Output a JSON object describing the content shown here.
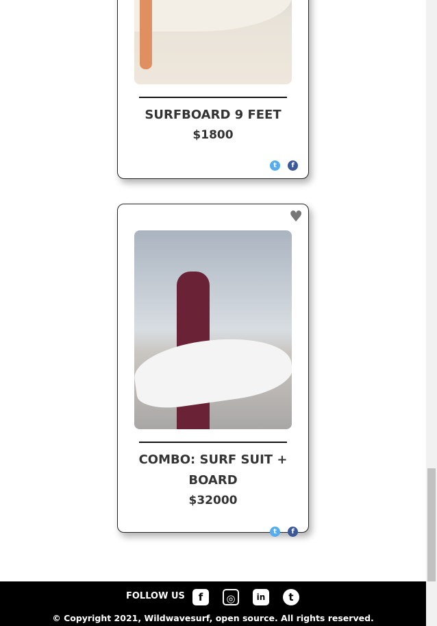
{
  "products": [
    {
      "title": "SURFBOARD 9 FEET",
      "price": "$1800"
    },
    {
      "title": "COMBO: SURF SUIT + BOARD",
      "price": "$32000"
    }
  ],
  "footer": {
    "follow": "FOLLOW US",
    "copyright": "© Copyright 2021, Wildwavesurf, open source. All rights reserved."
  },
  "colors": {
    "twitter": "#55acee",
    "facebook": "#3b5998",
    "footer_bg": "#000000"
  }
}
